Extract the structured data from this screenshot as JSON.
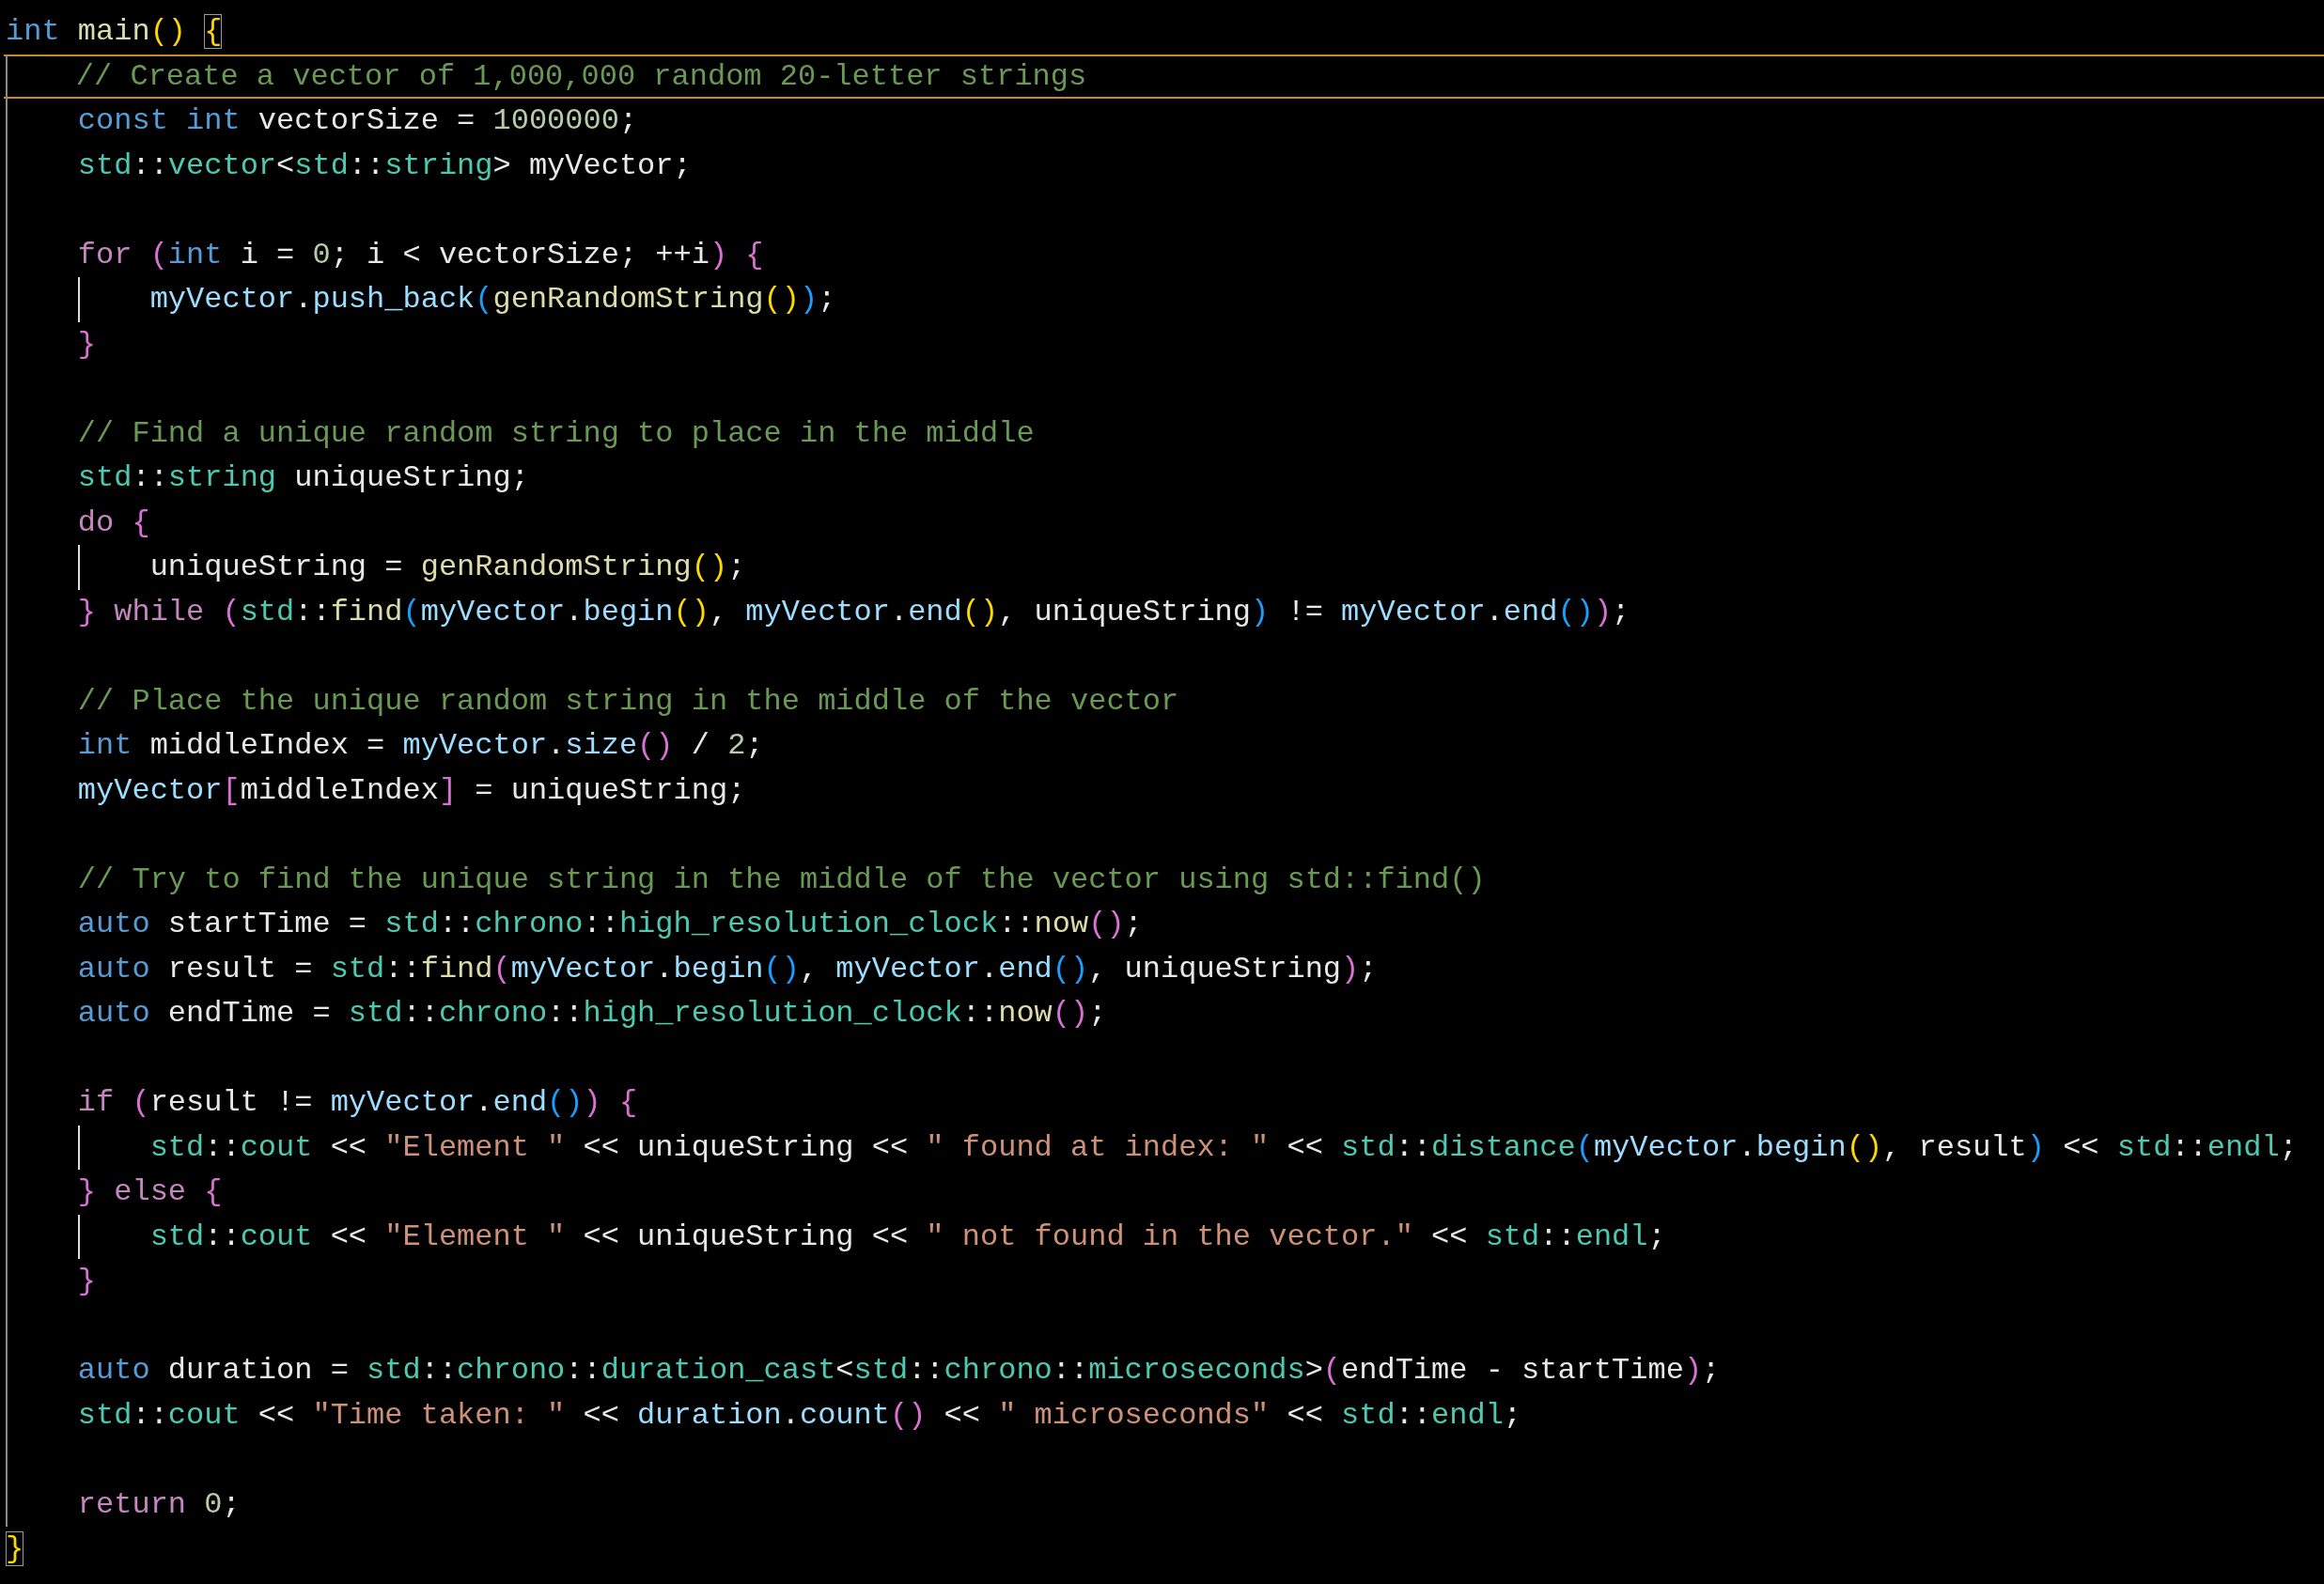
{
  "lines": [
    {
      "kind": "code",
      "tokens": [
        {
          "text": "int ",
          "kind": "kw"
        },
        {
          "text": "main",
          "kind": "fn"
        },
        {
          "text": "() ",
          "kind": "b1"
        },
        {
          "text": "{",
          "kind": "match"
        }
      ],
      "children": [
        {
          "kind": "code",
          "current": true,
          "tokens": [
            {
              "text": "// Create a vector of 1,000,000 random 20-letter strings",
              "kind": "com"
            }
          ]
        },
        {
          "kind": "code",
          "tokens": [
            {
              "text": "const int",
              "kind": "kw"
            },
            {
              "text": " vectorSize = ",
              "kind": "pl"
            },
            {
              "text": "1000000",
              "kind": "num"
            },
            {
              "text": ";",
              "kind": "pl"
            }
          ]
        },
        {
          "kind": "code",
          "tokens": [
            {
              "text": "std",
              "kind": "type"
            },
            {
              "text": "::",
              "kind": "pl"
            },
            {
              "text": "vector",
              "kind": "type"
            },
            {
              "text": "<",
              "kind": "pl"
            },
            {
              "text": "std",
              "kind": "type"
            },
            {
              "text": "::",
              "kind": "pl"
            },
            {
              "text": "string",
              "kind": "type"
            },
            {
              "text": "> myVector;",
              "kind": "pl"
            }
          ]
        },
        {
          "kind": "blank"
        },
        {
          "kind": "code",
          "tokens": [
            {
              "text": "for ",
              "kind": "ctrl"
            },
            {
              "text": "(",
              "kind": "b2"
            },
            {
              "text": "int",
              "kind": "kw"
            },
            {
              "text": " i = ",
              "kind": "pl"
            },
            {
              "text": "0",
              "kind": "num"
            },
            {
              "text": "; i < vectorSize; ++i",
              "kind": "pl"
            },
            {
              "text": ") ",
              "kind": "b2"
            },
            {
              "text": "{",
              "kind": "b2"
            }
          ],
          "children": [
            {
              "kind": "code",
              "tokens": [
                {
                  "text": "myVector",
                  "kind": "var"
                },
                {
                  "text": ".",
                  "kind": "pl"
                },
                {
                  "text": "push_back",
                  "kind": "var"
                },
                {
                  "text": "(",
                  "kind": "b3"
                },
                {
                  "text": "genRandomString",
                  "kind": "fn"
                },
                {
                  "text": "()",
                  "kind": "b1"
                },
                {
                  "text": ")",
                  "kind": "b3"
                },
                {
                  "text": ";",
                  "kind": "pl"
                }
              ]
            }
          ]
        },
        {
          "kind": "code",
          "tokens": [
            {
              "text": "}",
              "kind": "b2"
            }
          ]
        },
        {
          "kind": "blank"
        },
        {
          "kind": "code",
          "tokens": [
            {
              "text": "// Find a unique random string to place in the middle",
              "kind": "com"
            }
          ]
        },
        {
          "kind": "code",
          "tokens": [
            {
              "text": "std",
              "kind": "type"
            },
            {
              "text": "::",
              "kind": "pl"
            },
            {
              "text": "string",
              "kind": "type"
            },
            {
              "text": " uniqueString;",
              "kind": "pl"
            }
          ]
        },
        {
          "kind": "code",
          "tokens": [
            {
              "text": "do ",
              "kind": "ctrl"
            },
            {
              "text": "{",
              "kind": "b2"
            }
          ],
          "children": [
            {
              "kind": "code",
              "tokens": [
                {
                  "text": "uniqueString = ",
                  "kind": "pl"
                },
                {
                  "text": "genRandomString",
                  "kind": "fn"
                },
                {
                  "text": "()",
                  "kind": "b1"
                },
                {
                  "text": ";",
                  "kind": "pl"
                }
              ]
            }
          ]
        },
        {
          "kind": "code",
          "tokens": [
            {
              "text": "}",
              "kind": "b2"
            },
            {
              "text": " while ",
              "kind": "ctrl"
            },
            {
              "text": "(",
              "kind": "b2"
            },
            {
              "text": "std",
              "kind": "type"
            },
            {
              "text": "::",
              "kind": "pl"
            },
            {
              "text": "find",
              "kind": "fn"
            },
            {
              "text": "(",
              "kind": "b3"
            },
            {
              "text": "myVector",
              "kind": "var"
            },
            {
              "text": ".",
              "kind": "pl"
            },
            {
              "text": "begin",
              "kind": "var"
            },
            {
              "text": "()",
              "kind": "b1"
            },
            {
              "text": ", ",
              "kind": "pl"
            },
            {
              "text": "myVector",
              "kind": "var"
            },
            {
              "text": ".",
              "kind": "pl"
            },
            {
              "text": "end",
              "kind": "var"
            },
            {
              "text": "()",
              "kind": "b1"
            },
            {
              "text": ", uniqueString",
              "kind": "pl"
            },
            {
              "text": ")",
              "kind": "b3"
            },
            {
              "text": " != ",
              "kind": "pl"
            },
            {
              "text": "myVector",
              "kind": "var"
            },
            {
              "text": ".",
              "kind": "pl"
            },
            {
              "text": "end",
              "kind": "var"
            },
            {
              "text": "()",
              "kind": "b3"
            },
            {
              "text": ")",
              "kind": "b2"
            },
            {
              "text": ";",
              "kind": "pl"
            }
          ]
        },
        {
          "kind": "blank"
        },
        {
          "kind": "code",
          "tokens": [
            {
              "text": "// Place the unique random string in the middle of the vector",
              "kind": "com"
            }
          ]
        },
        {
          "kind": "code",
          "tokens": [
            {
              "text": "int",
              "kind": "kw"
            },
            {
              "text": " middleIndex = ",
              "kind": "pl"
            },
            {
              "text": "myVector",
              "kind": "var"
            },
            {
              "text": ".",
              "kind": "pl"
            },
            {
              "text": "size",
              "kind": "var"
            },
            {
              "text": "()",
              "kind": "b2"
            },
            {
              "text": " / ",
              "kind": "pl"
            },
            {
              "text": "2",
              "kind": "num"
            },
            {
              "text": ";",
              "kind": "pl"
            }
          ]
        },
        {
          "kind": "code",
          "tokens": [
            {
              "text": "myVector",
              "kind": "var"
            },
            {
              "text": "[",
              "kind": "b2"
            },
            {
              "text": "middleIndex",
              "kind": "pl"
            },
            {
              "text": "]",
              "kind": "b2"
            },
            {
              "text": " = uniqueString;",
              "kind": "pl"
            }
          ]
        },
        {
          "kind": "blank"
        },
        {
          "kind": "code",
          "tokens": [
            {
              "text": "// Try to find the unique string in the middle of the vector using std::find()",
              "kind": "com"
            }
          ]
        },
        {
          "kind": "code",
          "tokens": [
            {
              "text": "auto",
              "kind": "kw"
            },
            {
              "text": " startTime = ",
              "kind": "pl"
            },
            {
              "text": "std",
              "kind": "type"
            },
            {
              "text": "::",
              "kind": "pl"
            },
            {
              "text": "chrono",
              "kind": "type"
            },
            {
              "text": "::",
              "kind": "pl"
            },
            {
              "text": "high_resolution_clock",
              "kind": "type"
            },
            {
              "text": "::",
              "kind": "pl"
            },
            {
              "text": "now",
              "kind": "fn"
            },
            {
              "text": "()",
              "kind": "b2"
            },
            {
              "text": ";",
              "kind": "pl"
            }
          ]
        },
        {
          "kind": "code",
          "tokens": [
            {
              "text": "auto",
              "kind": "kw"
            },
            {
              "text": " result = ",
              "kind": "pl"
            },
            {
              "text": "std",
              "kind": "type"
            },
            {
              "text": "::",
              "kind": "pl"
            },
            {
              "text": "find",
              "kind": "fn"
            },
            {
              "text": "(",
              "kind": "b2"
            },
            {
              "text": "myVector",
              "kind": "var"
            },
            {
              "text": ".",
              "kind": "pl"
            },
            {
              "text": "begin",
              "kind": "var"
            },
            {
              "text": "()",
              "kind": "b3"
            },
            {
              "text": ", ",
              "kind": "pl"
            },
            {
              "text": "myVector",
              "kind": "var"
            },
            {
              "text": ".",
              "kind": "pl"
            },
            {
              "text": "end",
              "kind": "var"
            },
            {
              "text": "()",
              "kind": "b3"
            },
            {
              "text": ", uniqueString",
              "kind": "pl"
            },
            {
              "text": ")",
              "kind": "b2"
            },
            {
              "text": ";",
              "kind": "pl"
            }
          ]
        },
        {
          "kind": "code",
          "tokens": [
            {
              "text": "auto",
              "kind": "kw"
            },
            {
              "text": " endTime = ",
              "kind": "pl"
            },
            {
              "text": "std",
              "kind": "type"
            },
            {
              "text": "::",
              "kind": "pl"
            },
            {
              "text": "chrono",
              "kind": "type"
            },
            {
              "text": "::",
              "kind": "pl"
            },
            {
              "text": "high_resolution_clock",
              "kind": "type"
            },
            {
              "text": "::",
              "kind": "pl"
            },
            {
              "text": "now",
              "kind": "fn"
            },
            {
              "text": "()",
              "kind": "b2"
            },
            {
              "text": ";",
              "kind": "pl"
            }
          ]
        },
        {
          "kind": "blank"
        },
        {
          "kind": "code",
          "tokens": [
            {
              "text": "if ",
              "kind": "ctrl"
            },
            {
              "text": "(",
              "kind": "b2"
            },
            {
              "text": "result != ",
              "kind": "pl"
            },
            {
              "text": "myVector",
              "kind": "var"
            },
            {
              "text": ".",
              "kind": "pl"
            },
            {
              "text": "end",
              "kind": "var"
            },
            {
              "text": "()",
              "kind": "b3"
            },
            {
              "text": ") ",
              "kind": "b2"
            },
            {
              "text": "{",
              "kind": "b2"
            }
          ],
          "children": [
            {
              "kind": "code",
              "tokens": [
                {
                  "text": "std",
                  "kind": "type"
                },
                {
                  "text": "::",
                  "kind": "pl"
                },
                {
                  "text": "cout",
                  "kind": "type"
                },
                {
                  "text": " << ",
                  "kind": "pl"
                },
                {
                  "text": "\"Element \"",
                  "kind": "str"
                },
                {
                  "text": " << uniqueString << ",
                  "kind": "pl"
                },
                {
                  "text": "\" found at index: \"",
                  "kind": "str"
                },
                {
                  "text": " << ",
                  "kind": "pl"
                },
                {
                  "text": "std",
                  "kind": "type"
                },
                {
                  "text": "::",
                  "kind": "pl"
                },
                {
                  "text": "distance",
                  "kind": "type"
                },
                {
                  "text": "(",
                  "kind": "b3"
                },
                {
                  "text": "myVector",
                  "kind": "var"
                },
                {
                  "text": ".",
                  "kind": "pl"
                },
                {
                  "text": "begin",
                  "kind": "var"
                },
                {
                  "text": "()",
                  "kind": "b1"
                },
                {
                  "text": ", result",
                  "kind": "pl"
                },
                {
                  "text": ")",
                  "kind": "b3"
                },
                {
                  "text": " << ",
                  "kind": "pl"
                },
                {
                  "text": "std",
                  "kind": "type"
                },
                {
                  "text": "::",
                  "kind": "pl"
                },
                {
                  "text": "endl",
                  "kind": "type"
                },
                {
                  "text": ";",
                  "kind": "pl"
                }
              ]
            }
          ]
        },
        {
          "kind": "code",
          "tokens": [
            {
              "text": "}",
              "kind": "b2"
            },
            {
              "text": " else ",
              "kind": "ctrl"
            },
            {
              "text": "{",
              "kind": "b2"
            }
          ],
          "children": [
            {
              "kind": "code",
              "tokens": [
                {
                  "text": "std",
                  "kind": "type"
                },
                {
                  "text": "::",
                  "kind": "pl"
                },
                {
                  "text": "cout",
                  "kind": "type"
                },
                {
                  "text": " << ",
                  "kind": "pl"
                },
                {
                  "text": "\"Element \"",
                  "kind": "str"
                },
                {
                  "text": " << uniqueString << ",
                  "kind": "pl"
                },
                {
                  "text": "\" not found in the vector.\"",
                  "kind": "str"
                },
                {
                  "text": " << ",
                  "kind": "pl"
                },
                {
                  "text": "std",
                  "kind": "type"
                },
                {
                  "text": "::",
                  "kind": "pl"
                },
                {
                  "text": "endl",
                  "kind": "type"
                },
                {
                  "text": ";",
                  "kind": "pl"
                }
              ]
            }
          ]
        },
        {
          "kind": "code",
          "tokens": [
            {
              "text": "}",
              "kind": "b2"
            }
          ]
        },
        {
          "kind": "blank"
        },
        {
          "kind": "code",
          "tokens": [
            {
              "text": "auto",
              "kind": "kw"
            },
            {
              "text": " duration = ",
              "kind": "pl"
            },
            {
              "text": "std",
              "kind": "type"
            },
            {
              "text": "::",
              "kind": "pl"
            },
            {
              "text": "chrono",
              "kind": "type"
            },
            {
              "text": "::",
              "kind": "pl"
            },
            {
              "text": "duration_cast",
              "kind": "type"
            },
            {
              "text": "<",
              "kind": "pl"
            },
            {
              "text": "std",
              "kind": "type"
            },
            {
              "text": "::",
              "kind": "pl"
            },
            {
              "text": "chrono",
              "kind": "type"
            },
            {
              "text": "::",
              "kind": "pl"
            },
            {
              "text": "microseconds",
              "kind": "type"
            },
            {
              "text": ">",
              "kind": "pl"
            },
            {
              "text": "(",
              "kind": "b2"
            },
            {
              "text": "endTime - startTime",
              "kind": "pl"
            },
            {
              "text": ")",
              "kind": "b2"
            },
            {
              "text": ";",
              "kind": "pl"
            }
          ]
        },
        {
          "kind": "code",
          "tokens": [
            {
              "text": "std",
              "kind": "type"
            },
            {
              "text": "::",
              "kind": "pl"
            },
            {
              "text": "cout",
              "kind": "type"
            },
            {
              "text": " << ",
              "kind": "pl"
            },
            {
              "text": "\"Time taken: \"",
              "kind": "str"
            },
            {
              "text": " << ",
              "kind": "pl"
            },
            {
              "text": "duration",
              "kind": "var"
            },
            {
              "text": ".",
              "kind": "pl"
            },
            {
              "text": "count",
              "kind": "var"
            },
            {
              "text": "()",
              "kind": "b2"
            },
            {
              "text": " << ",
              "kind": "pl"
            },
            {
              "text": "\" microseconds\"",
              "kind": "str"
            },
            {
              "text": " << ",
              "kind": "pl"
            },
            {
              "text": "std",
              "kind": "type"
            },
            {
              "text": "::",
              "kind": "pl"
            },
            {
              "text": "endl",
              "kind": "type"
            },
            {
              "text": ";",
              "kind": "pl"
            }
          ]
        },
        {
          "kind": "blank"
        },
        {
          "kind": "code",
          "tokens": [
            {
              "text": "return ",
              "kind": "ctrl"
            },
            {
              "text": "0",
              "kind": "num"
            },
            {
              "text": ";",
              "kind": "pl"
            }
          ]
        }
      ]
    },
    {
      "kind": "code",
      "tokens": [
        {
          "text": "}",
          "kind": "match"
        }
      ]
    }
  ]
}
